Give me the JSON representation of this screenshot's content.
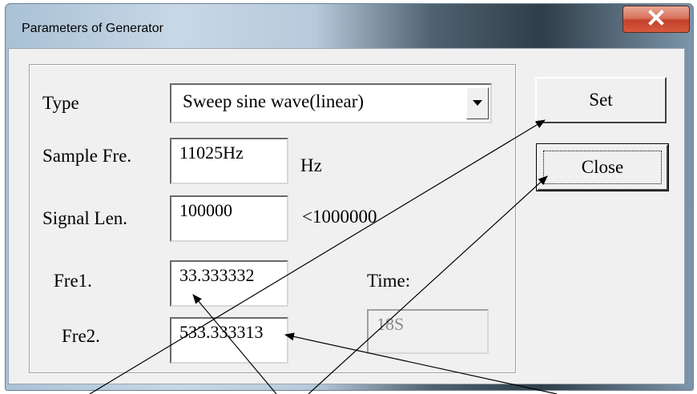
{
  "window": {
    "title": "Parameters of Generator",
    "close_glyph": "✕"
  },
  "form": {
    "type_label": "Type",
    "type_value": "Sweep sine wave(linear)",
    "sample_label": "Sample Fre.",
    "sample_value": "11025Hz",
    "sample_unit": "Hz",
    "length_label": "Signal Len.",
    "length_value": "100000",
    "length_hint": "<1000000",
    "fre1_label": "Fre1.",
    "fre1_value": "33.333332",
    "fre2_label": "Fre2.",
    "fre2_value": "533.333313",
    "time_label": "Time:",
    "time_value": "18S"
  },
  "buttons": {
    "set_label": "Set",
    "close_label": "Close"
  },
  "icons": {
    "dropdown": "dropdown-arrow-icon",
    "close": "close-icon"
  },
  "colors": {
    "face": "#f0f0f0",
    "close_red": "#c4402a"
  }
}
